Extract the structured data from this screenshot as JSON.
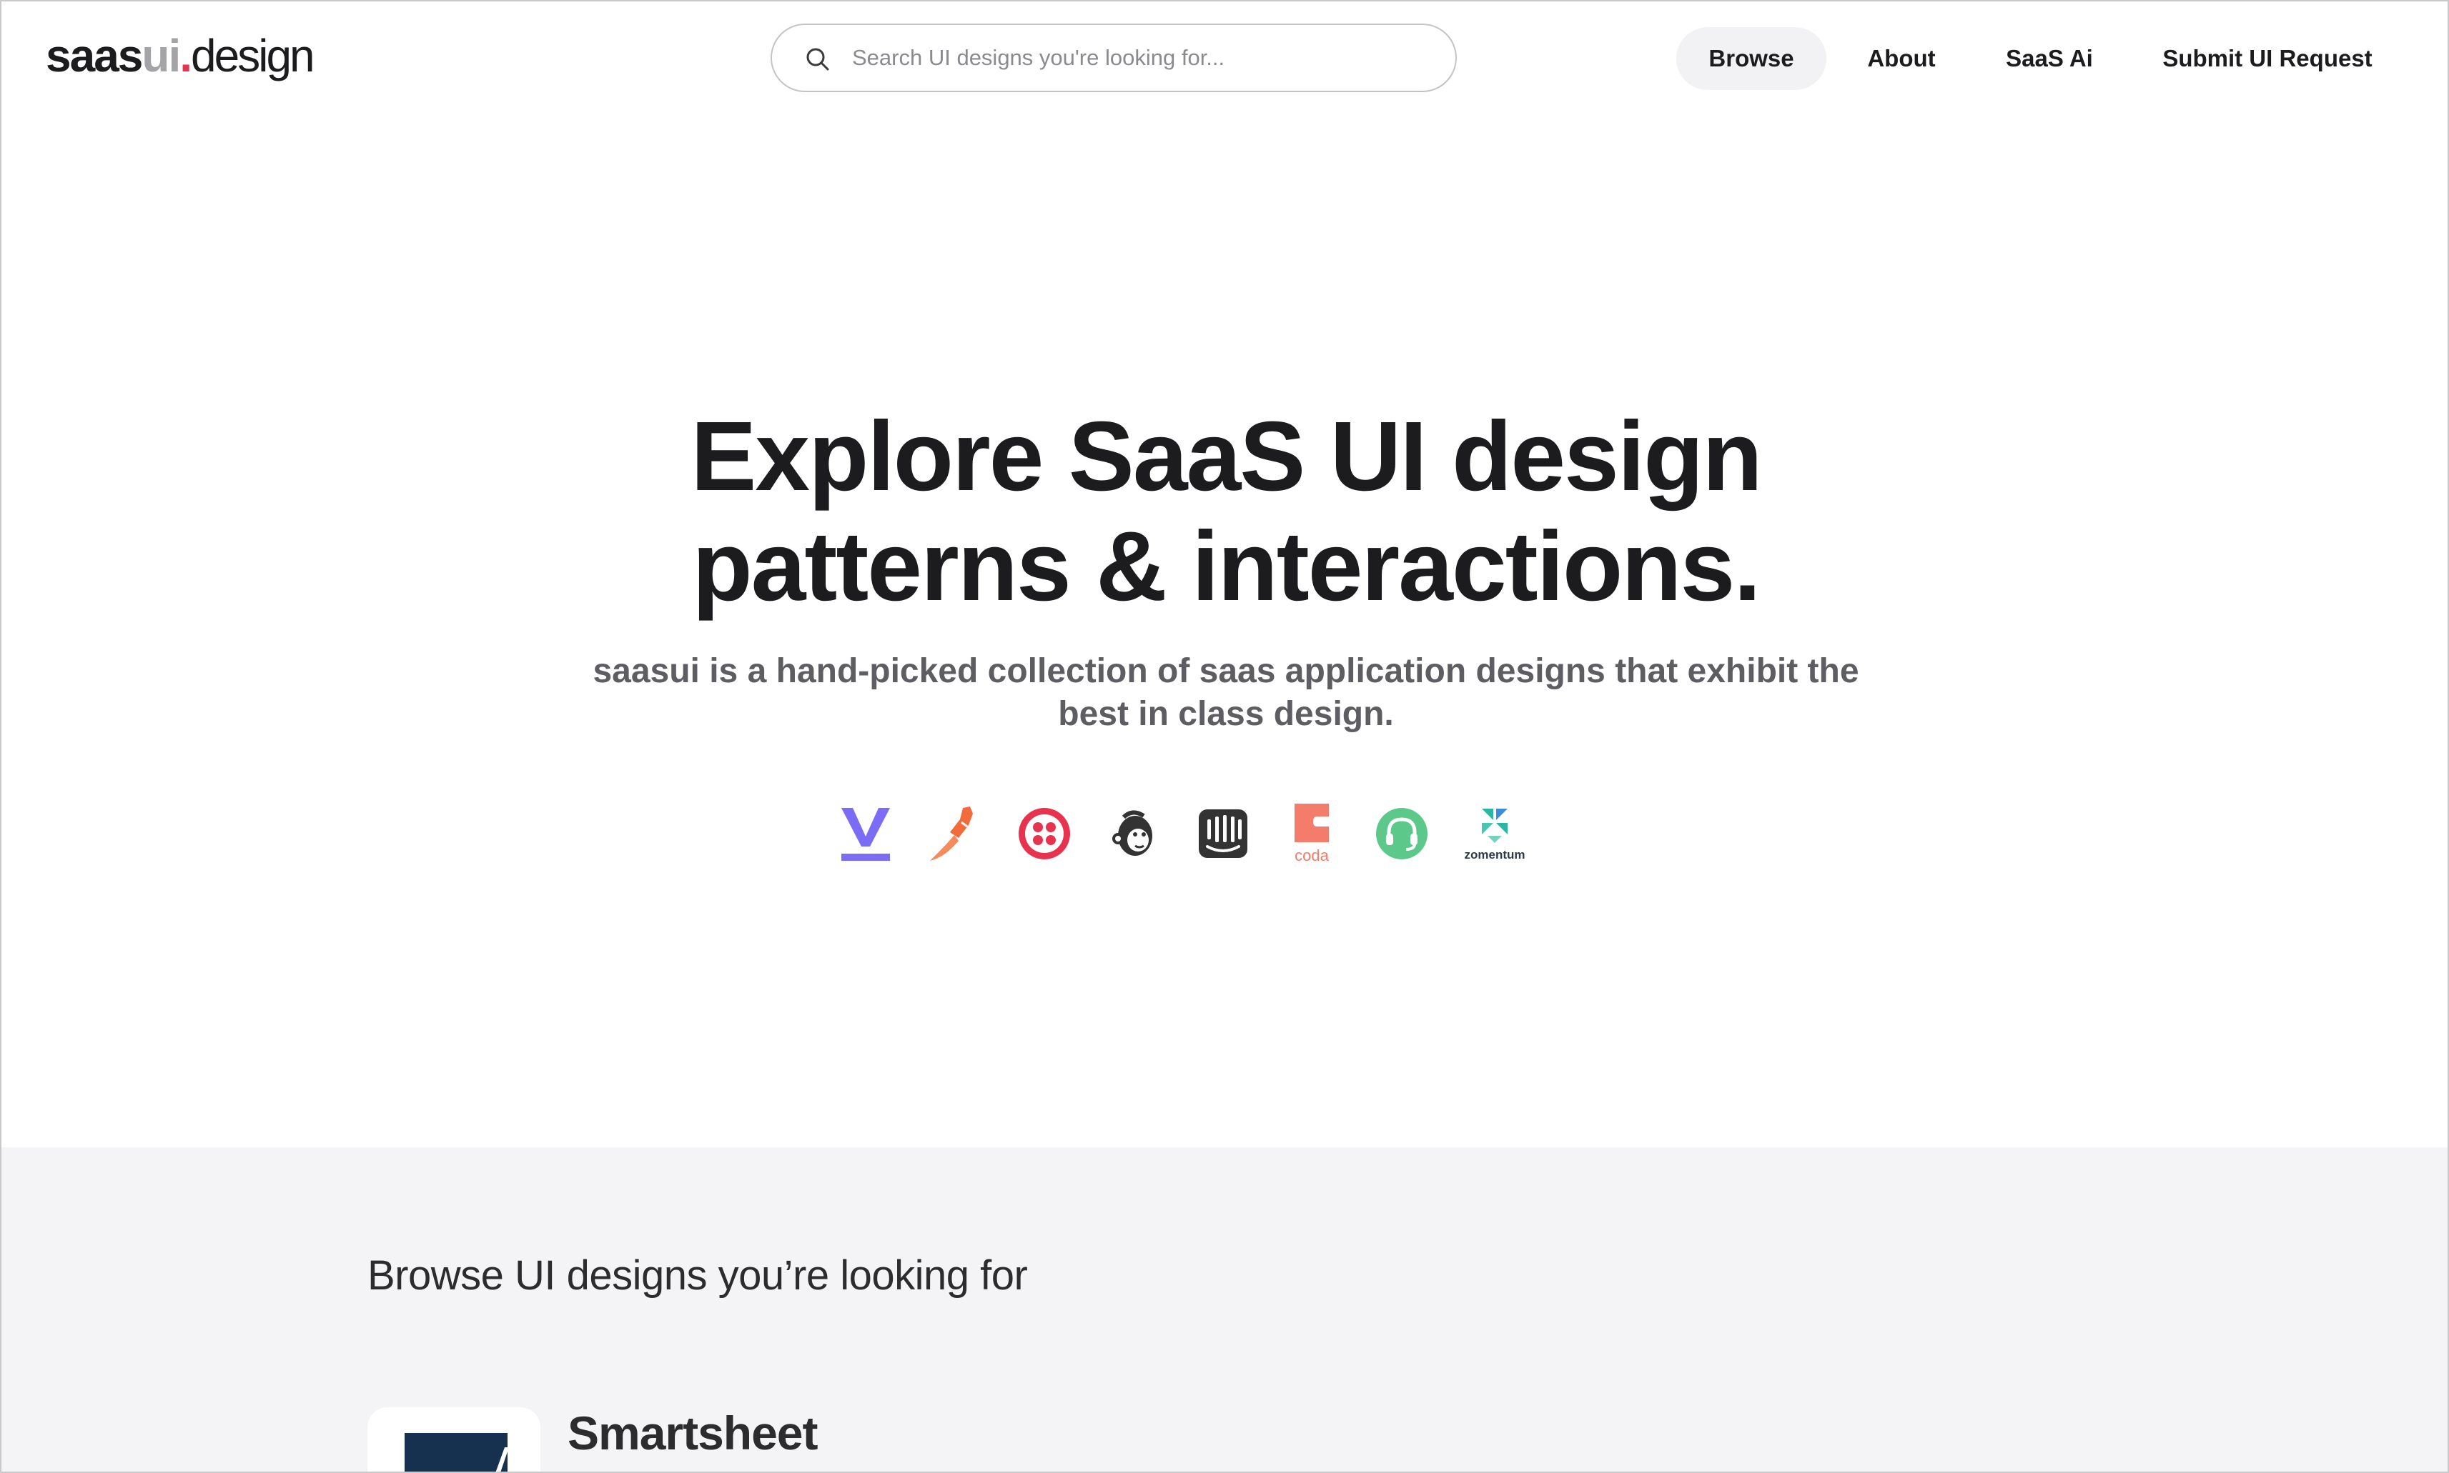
{
  "header": {
    "logo": {
      "part_saas": "saas",
      "part_ui": "ui",
      "part_dot": ".",
      "part_design": "design"
    },
    "search": {
      "placeholder": "Search UI designs you're looking for...",
      "value": "",
      "icon": "search-icon"
    },
    "nav": [
      {
        "label": "Browse",
        "active": true
      },
      {
        "label": "About",
        "active": false
      },
      {
        "label": "SaaS Ai",
        "active": false
      },
      {
        "label": "Submit UI Request",
        "active": false
      }
    ]
  },
  "hero": {
    "title_line1": "Explore SaaS UI design",
    "title_line2": "patterns & interactions.",
    "subtitle_line1": "saasui is a hand-picked collection of saas application designs that exhibit the",
    "subtitle_line2": "best in class design.",
    "brand_logos": [
      {
        "icon": "v-logo-icon",
        "color": "#7b6cf6"
      },
      {
        "icon": "brush-logo-icon",
        "color": "#f26b3a"
      },
      {
        "icon": "twilio-logo-icon",
        "color": "#e8334f"
      },
      {
        "icon": "mailchimp-logo-icon",
        "color": "#333333"
      },
      {
        "icon": "intercom-logo-icon",
        "color": "#333333"
      },
      {
        "icon": "coda-logo-icon",
        "color": "#f47c6a",
        "text": "coda"
      },
      {
        "icon": "support-headset-logo-icon",
        "color": "#5cc98a"
      },
      {
        "icon": "zomentum-logo-icon",
        "color": "#2bb5a3",
        "text": "zomentum"
      }
    ]
  },
  "browse": {
    "heading": "Browse UI designs you’re looking for",
    "first_card": {
      "title": "Smartsheet",
      "logo_icon": "smartsheet-logo-icon",
      "logo_color": "#16304f"
    }
  },
  "colors": {
    "accent": "#e8334f",
    "text": "#1c1c1e",
    "muted": "#5d5d62",
    "section_bg": "#f4f4f6",
    "nav_active_bg": "#f2f2f4"
  }
}
